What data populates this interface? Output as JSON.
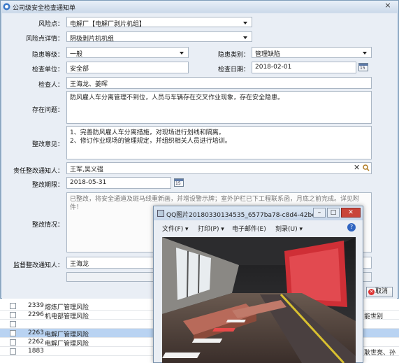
{
  "window": {
    "title": "公司级安全检查通知单",
    "close": "×"
  },
  "form": {
    "risk_point": {
      "label": "风险点：",
      "value": "电解厂【电解厂剥片机组】"
    },
    "risk_detail": {
      "label": "风险点详情：",
      "value": "阴极剥片机机组"
    },
    "hazard_level": {
      "label": "隐患等级：",
      "value": "一般"
    },
    "hazard_type": {
      "label": "隐患类别：",
      "value": "管理缺陷"
    },
    "inspect_unit": {
      "label": "检查单位：",
      "value": "安全部"
    },
    "inspect_date": {
      "label": "检查日期：",
      "value": "2018-02-01",
      "cal": "15"
    },
    "inspector": {
      "label": "检查人：",
      "value": "王海龙、姜晖"
    },
    "problem": {
      "label": "存在问题：",
      "value": "防风雇人车分离管理不到位，人员与车辆存在交叉作业现象，存在安全隐患。"
    },
    "opinion": {
      "label": "整改意见：",
      "value": "1、完善防风雇人车分离措施，对现场进行划线和隔离。\n2、修订作业现场的管理规定，并组织相关人员进行培训。"
    },
    "notify": {
      "label": "责任整改通知人：",
      "value": "王军,吴义强"
    },
    "deadline": {
      "label": "整改期限：",
      "value": "2018-05-31",
      "cal": "15"
    },
    "status": {
      "label": "整改情况：",
      "value": "已整改，将安全通道及斑马线重新画，并增设警示牌；室外护栏已下工程联系函，月底之前完成。详见附件！"
    },
    "supervisor": {
      "label": "监督整改通知人：",
      "value": "王海龙"
    },
    "cancel_label": "取消"
  },
  "background_table": {
    "rows": [
      {
        "id": "2339",
        "name": "熔炼厂管理风险",
        "extra": "",
        "selected": false
      },
      {
        "id": "2296",
        "name": "机电部管理风险",
        "extra": "能世别",
        "selected": false
      },
      {
        "id": "",
        "name": "",
        "extra": "",
        "selected": false
      },
      {
        "id": "2263",
        "name": "电解厂管理风险",
        "extra": "",
        "selected": true
      },
      {
        "id": "2262",
        "name": "电解厂管理风险",
        "extra": "",
        "selected": false
      },
      {
        "id": "1883",
        "name": "",
        "extra": "耿世亮、孙",
        "selected": false
      }
    ]
  },
  "viewer": {
    "title": "QQ图片20180330134535_6577ba78-c8d4-42be...",
    "menu": [
      "文件(F) ▾",
      "打印(P) ▾",
      "电子邮件(E)",
      "刻录(U) ▾"
    ],
    "help": "?",
    "buttons": {
      "min": "–",
      "max": "□",
      "close": "✕"
    }
  }
}
